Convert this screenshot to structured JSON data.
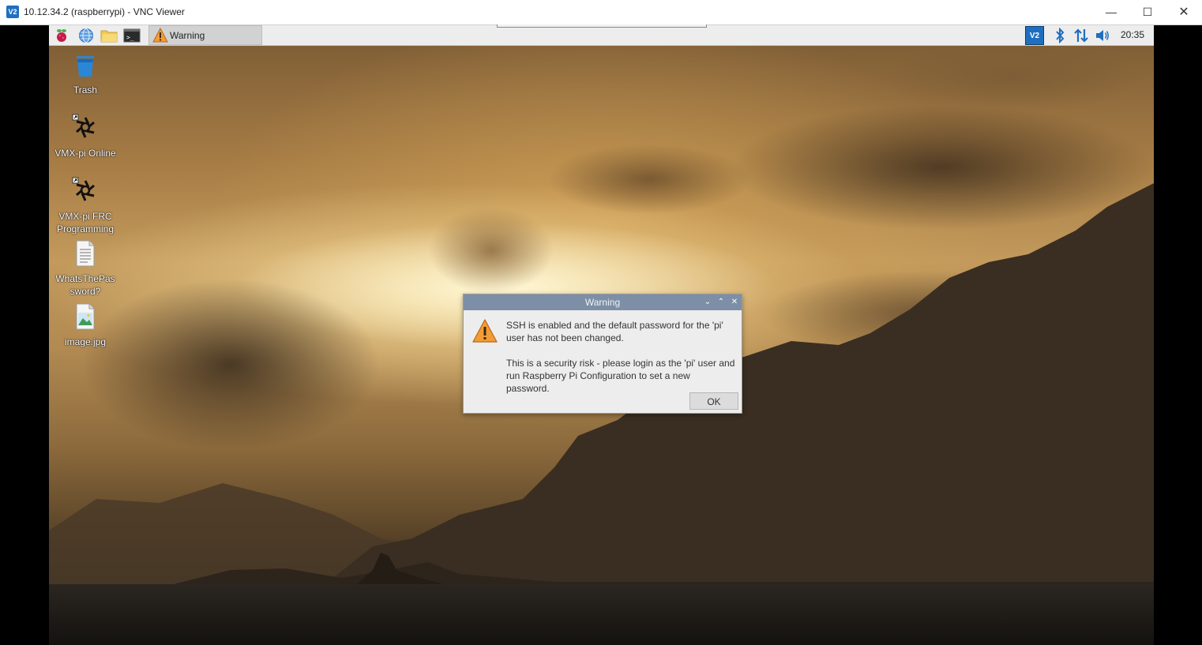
{
  "window": {
    "title": "10.12.34.2 (raspberrypi) - VNC Viewer",
    "app_icon": "vnc-viewer-icon",
    "app_icon_text": "V2",
    "minimize": "—",
    "maximize": "☐",
    "close": "✕"
  },
  "taskbar": {
    "launchers": [
      "raspberry-menu-icon",
      "web-browser-icon",
      "file-manager-icon",
      "terminal-icon"
    ],
    "terminal_glyph": ">_",
    "task_button_label": "Warning",
    "tray": [
      "vnc-server-icon",
      "bluetooth-icon",
      "network-icon",
      "volume-icon"
    ],
    "vnc_tray_text": "V2",
    "clock": "20:35"
  },
  "desktop": {
    "icons": [
      {
        "label": "Trash",
        "icon": "trash-icon"
      },
      {
        "label": "VMX-pi Online",
        "icon": "vmx-pi-icon"
      },
      {
        "label": "VMX-pi FRC Programming",
        "icon": "vmx-pi-icon"
      },
      {
        "label": "WhatsThePassword?",
        "icon": "text-file-icon"
      },
      {
        "label": "image.jpg",
        "icon": "image-file-icon"
      }
    ]
  },
  "dialog": {
    "title": "Warning",
    "icon": "warning-icon",
    "message_line1": "SSH is enabled and the default password for the 'pi' user has not been changed.",
    "message_line2": "This is a security risk - please login as the 'pi' user and run Raspberry Pi Configuration to set a new password.",
    "ok_label": "OK",
    "controls": {
      "minimize": "⌄",
      "maximize": "⌃",
      "close": "✕"
    }
  },
  "colors": {
    "dialog_titlebar": "#7d8fa6",
    "taskbar": "#ededed",
    "vnc_blue": "#1f6fc0"
  }
}
